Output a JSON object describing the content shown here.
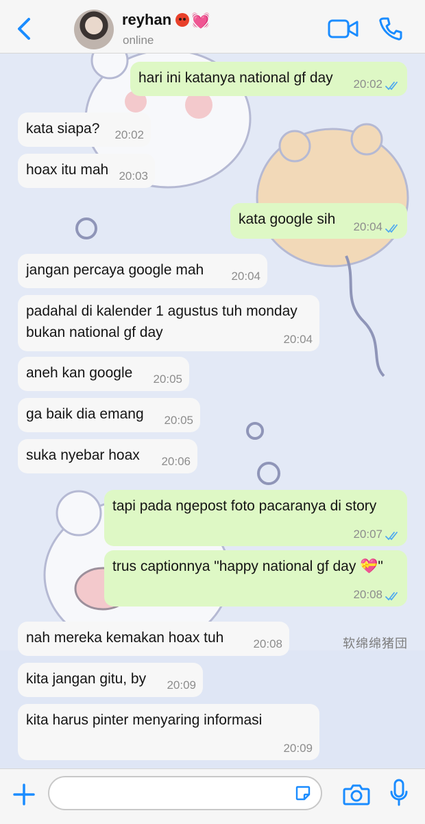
{
  "header": {
    "contact_name": "reyhan",
    "status": "online",
    "name_emojis": [
      "angry-face-emoji",
      "sparkling-heart-emoji"
    ]
  },
  "watermark": "软绵绵猪団",
  "colors": {
    "accent": "#1a8cff",
    "outgoing_bubble": "#def8c5",
    "incoming_bubble": "#f7f7f7",
    "wallpaper": "#e3e9f6",
    "read_ticks": "#4fa9ef"
  },
  "messages": [
    {
      "dir": "out",
      "text": "hari ini katanya national gf day",
      "time": "20:02"
    },
    {
      "dir": "in",
      "text": "kata siapa?",
      "time": "20:02"
    },
    {
      "dir": "in",
      "text": "hoax itu mah",
      "time": "20:03"
    },
    {
      "dir": "out",
      "text": "kata google sih",
      "time": "20:04"
    },
    {
      "dir": "in",
      "text": "jangan percaya google mah",
      "time": "20:04"
    },
    {
      "dir": "in",
      "text": "padahal di kalender 1 agustus tuh monday bukan national gf day",
      "time": "20:04"
    },
    {
      "dir": "in",
      "text": "aneh kan google",
      "time": "20:05"
    },
    {
      "dir": "in",
      "text": "ga baik dia emang",
      "time": "20:05"
    },
    {
      "dir": "in",
      "text": "suka nyebar hoax",
      "time": "20:06"
    },
    {
      "dir": "out",
      "text": "tapi pada ngepost foto pacaranya di story",
      "time": "20:07"
    },
    {
      "dir": "out",
      "text": "trus captionnya \"happy national gf day 💝\"",
      "time": "20:08"
    },
    {
      "dir": "in",
      "text": "nah mereka kemakan hoax tuh",
      "time": "20:08"
    },
    {
      "dir": "in",
      "text": "kita jangan gitu, by",
      "time": "20:09"
    },
    {
      "dir": "in",
      "text": "kita harus pinter menyaring informasi",
      "time": "20:09"
    }
  ],
  "composer": {
    "input_value": "",
    "icons": [
      "plus-icon",
      "sticker-icon",
      "camera-icon",
      "microphone-icon"
    ]
  }
}
